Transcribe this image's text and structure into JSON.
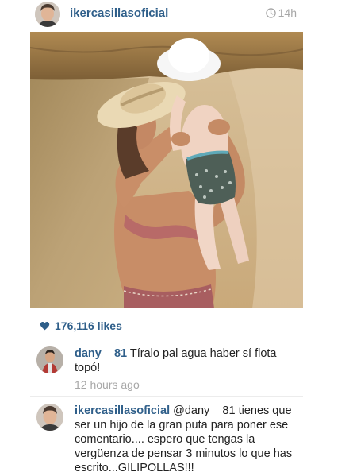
{
  "header": {
    "username": "ikercasillasoficial",
    "time": "14h",
    "icons": {
      "avatar": "user-avatar",
      "clock": "clock-icon"
    }
  },
  "photo": {
    "description_icon": "post-photo"
  },
  "likes": {
    "icon": "heart-icon",
    "count": "176,116 likes"
  },
  "comments": [
    {
      "username": "dany__81",
      "text": "Tíralo pal agua haber sí flota topó!",
      "time": "12 hours ago"
    },
    {
      "username": "ikercasillasoficial",
      "text": "@dany__81 tienes que ser un hijo de la gran puta para poner ese comentario.... espero que tengas la vergüenza de pensar 3 minutos lo que has escrito...GILIPOLLAS!!!"
    }
  ],
  "colors": {
    "username_blue": "#2f5f8a",
    "meta_gray": "#a7a7a7",
    "heart": "#2f5f8a"
  }
}
